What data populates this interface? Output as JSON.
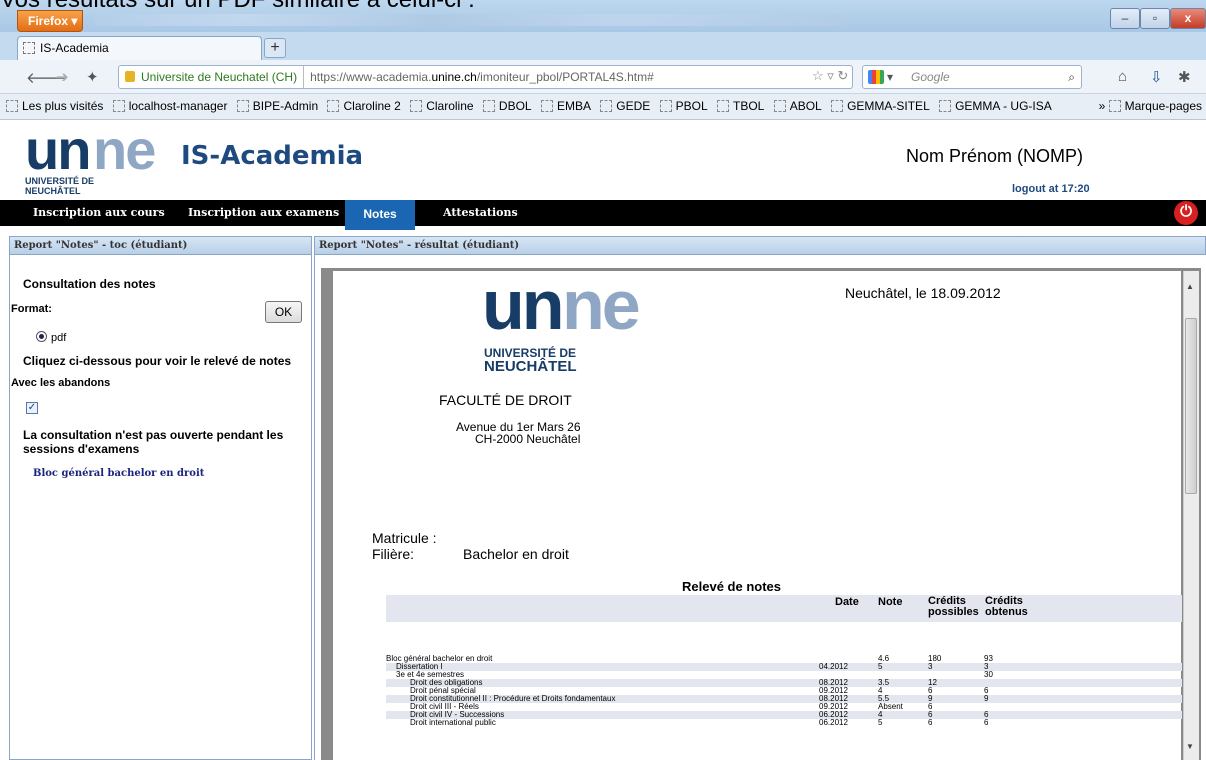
{
  "caption": "Vos résultats sur un PDF similaire à celui-ci :",
  "browser": {
    "app_button": "Firefox ▾",
    "tab_title": "IS-Academia",
    "identity": "Universite de Neuchatel (CH)",
    "url_prefix": "https://www-academia.",
    "url_host": "unine.ch",
    "url_path": "/imoniteur_pbol/PORTAL4S.htm#",
    "search_placeholder": "Google",
    "bookmarks": [
      "Les plus visités",
      "localhost-manager",
      "BIPE-Admin",
      "Claroline 2",
      "Claroline",
      "DBOL",
      "EMBA",
      "GEDE",
      "PBOL",
      "TBOL",
      "ABOL",
      "GEMMA-SITEL",
      "GEMMA - UG-ISA"
    ],
    "bookmarks_menu": "Marque-pages"
  },
  "header": {
    "logo_un": "un",
    "logo_ne": "ne",
    "logo_sub1": "UNIVERSITÉ DE",
    "logo_sub2": "NEUCHÂTEL",
    "app_title": "IS-Academia",
    "user_name": "Nom Prénom (NOMP)",
    "logout": "logout at 17:20"
  },
  "menu": {
    "items": [
      "Inscription aux cours",
      "Inscription aux examens",
      "Notes",
      "Attestations"
    ]
  },
  "left_panel": {
    "header": "Report \"Notes\" - toc (étudiant)",
    "title": "Consultation des notes",
    "format_label": "Format:",
    "ok_label": "OK",
    "format_option": "pdf",
    "instruction": "Cliquez ci-dessous pour voir le relevé de notes",
    "abandons_label": "Avec les abandons",
    "warning": "La consultation n'est pas ouverte pendant les sessions d'examens",
    "link": "Bloc général bachelor en droit"
  },
  "right_panel": {
    "header": "Report \"Notes\" - résultat (étudiant)"
  },
  "pdf": {
    "date_line": "Neuchâtel, le 18.09.2012",
    "faculty": "FACULTÉ DE DROIT",
    "address1": "Avenue du 1er Mars 26",
    "address2": "CH-2000 Neuchâtel",
    "matricule_label": "Matricule :",
    "filiere_label": "Filière:",
    "filiere_value": "Bachelor en droit",
    "releve_title": "Relevé de notes",
    "col_date": "Date",
    "col_note": "Note",
    "col_credits_possibles": "Crédits possibles",
    "col_credits_obtenus": "Crédits obtenus",
    "rows": [
      {
        "label": "Bloc général bachelor en droit",
        "indent": 0,
        "date": "",
        "note": "4.6",
        "possible": "180",
        "obtained": "93"
      },
      {
        "label": "Dissertation I",
        "indent": 1,
        "date": "04.2012",
        "note": "5",
        "possible": "3",
        "obtained": "3"
      },
      {
        "label": "3e et 4e semestres",
        "indent": 1,
        "date": "",
        "note": "",
        "possible": "",
        "obtained": "30"
      },
      {
        "label": "Droit des obligations",
        "indent": 2,
        "date": "08.2012",
        "note": "3.5",
        "possible": "12",
        "obtained": ""
      },
      {
        "label": "Droit pénal spécial",
        "indent": 2,
        "date": "09.2012",
        "note": "4",
        "possible": "6",
        "obtained": "6"
      },
      {
        "label": "Droit constitutionnel II : Procédure et Droits fondamentaux",
        "indent": 2,
        "date": "08.2012",
        "note": "5.5",
        "possible": "9",
        "obtained": "9"
      },
      {
        "label": "Droit civil III - Réels",
        "indent": 2,
        "date": "09.2012",
        "note": "Absent",
        "possible": "6",
        "obtained": ""
      },
      {
        "label": "Droit civil IV - Successions",
        "indent": 2,
        "date": "06.2012",
        "note": "4",
        "possible": "6",
        "obtained": "6"
      },
      {
        "label": "Droit international public",
        "indent": 2,
        "date": "06.2012",
        "note": "5",
        "possible": "6",
        "obtained": "6"
      }
    ]
  }
}
